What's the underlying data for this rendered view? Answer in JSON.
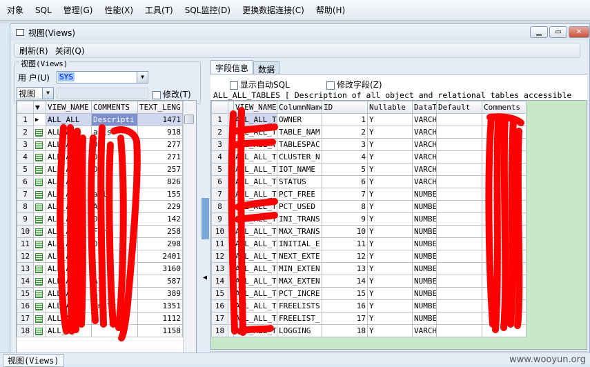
{
  "menu": [
    "对象",
    "SQL",
    "管理(G)",
    "性能(X)",
    "工具(T)",
    "SQL监控(D)",
    "更换数据连接(C)",
    "帮助(H)"
  ],
  "window": {
    "title": "视图(Views)"
  },
  "toolbar": {
    "refresh": "刷新(R)",
    "close": "关闭(Q)"
  },
  "left": {
    "group_legend": "视图(Views)",
    "user_label": "用 户(U)",
    "user_value": "SYS",
    "type_value": "视图",
    "modify_label": "修改(T)",
    "columns": [
      "VIEW_NAME",
      "COMMENTS",
      "TEXT_LENG"
    ],
    "rows": [
      {
        "n": "1",
        "name": "ALL_ALL",
        "comm": "Descripti",
        "len": "1471"
      },
      {
        "n": "2",
        "name": "ALL_AP",
        "comm": "ails",
        "len": "918"
      },
      {
        "n": "3",
        "name": "ALL_AP",
        "comm": "De",
        "len": "277"
      },
      {
        "n": "4",
        "name": "ALL_AP",
        "comm": "De",
        "len": "271"
      },
      {
        "n": "5",
        "name": "ALL_AP",
        "comm": "De",
        "len": "257"
      },
      {
        "n": "6",
        "name": "ALL_AP",
        "comm": "",
        "len": "826"
      },
      {
        "n": "7",
        "name": "ALL_AP",
        "comm": "ail",
        "len": "155"
      },
      {
        "n": "8",
        "name": "ALL_AP",
        "comm": "Ar",
        "len": "229"
      },
      {
        "n": "9",
        "name": "ALL_AP",
        "comm": "D",
        "len": "142"
      },
      {
        "n": "10",
        "name": "ALL_AP",
        "comm": "For",
        "len": "258"
      },
      {
        "n": "11",
        "name": "ALL_AP",
        "comm": "De",
        "len": "298"
      },
      {
        "n": "12",
        "name": "ALL_AR",
        "comm": "",
        "len": "2401"
      },
      {
        "n": "13",
        "name": "ALL_AS",
        "comm": "",
        "len": "3160"
      },
      {
        "n": "14",
        "name": "ALL_AU",
        "comm": "All",
        "len": "587"
      },
      {
        "n": "15",
        "name": "ALL_AU",
        "comm": "All",
        "len": "389"
      },
      {
        "n": "16",
        "name": "ALL_AW",
        "comm": "Analy",
        "len": "1351"
      },
      {
        "n": "17",
        "name": "ALL_AW",
        "comm": "",
        "len": "1112"
      },
      {
        "n": "18",
        "name": "ALL_AW",
        "comm": "",
        "len": "1158"
      }
    ]
  },
  "right": {
    "tabs": [
      "字段信息",
      "数据"
    ],
    "show_sql": "显示自动SQL",
    "modify_field": "修改字段(Z)",
    "description": "ALL_ALL_TABLES [ Description of all object and relational tables accessible",
    "columns": [
      "VIEW_NAME",
      "ColumnName",
      "ID",
      "Nullable",
      "DataT",
      "Default",
      "Comments"
    ],
    "rows": [
      {
        "n": "1",
        "v": "ALL_ALL_T",
        "c": "OWNER",
        "id": "1",
        "nl": "Y",
        "dt": "VARCH"
      },
      {
        "n": "2",
        "v": "ALL_ALL_T",
        "c": "TABLE_NAM",
        "id": "2",
        "nl": "Y",
        "dt": "VARCH"
      },
      {
        "n": "3",
        "v": "ALL_ALL_T",
        "c": "TABLESPAC",
        "id": "3",
        "nl": "Y",
        "dt": "VARCH"
      },
      {
        "n": "4",
        "v": "ALL_ALL_T",
        "c": "CLUSTER_N",
        "id": "4",
        "nl": "Y",
        "dt": "VARCH"
      },
      {
        "n": "5",
        "v": "ALL_ALL_T",
        "c": "IOT_NAME",
        "id": "5",
        "nl": "Y",
        "dt": "VARCH"
      },
      {
        "n": "6",
        "v": "ALL_ALL_T",
        "c": "STATUS",
        "id": "6",
        "nl": "Y",
        "dt": "VARCH"
      },
      {
        "n": "7",
        "v": "ALL_ALL_T",
        "c": "PCT_FREE",
        "id": "7",
        "nl": "Y",
        "dt": "NUMBE"
      },
      {
        "n": "8",
        "v": "ALL_ALL_T",
        "c": "PCT_USED",
        "id": "8",
        "nl": "Y",
        "dt": "NUMBE"
      },
      {
        "n": "9",
        "v": "ALL_ALL_T",
        "c": "INI_TRANS",
        "id": "9",
        "nl": "Y",
        "dt": "NUMBE"
      },
      {
        "n": "10",
        "v": "ALL_ALL_T",
        "c": "MAX_TRANS",
        "id": "10",
        "nl": "Y",
        "dt": "NUMBE"
      },
      {
        "n": "11",
        "v": "ALL_ALL_T",
        "c": "INITIAL_E",
        "id": "11",
        "nl": "Y",
        "dt": "NUMBE"
      },
      {
        "n": "12",
        "v": "ALL_ALL_T",
        "c": "NEXT_EXTE",
        "id": "12",
        "nl": "Y",
        "dt": "NUMBE"
      },
      {
        "n": "13",
        "v": "ALL_ALL_T",
        "c": "MIN_EXTEN",
        "id": "13",
        "nl": "Y",
        "dt": "NUMBE"
      },
      {
        "n": "14",
        "v": "ALL_ALL_T",
        "c": "MAX_EXTEN",
        "id": "14",
        "nl": "Y",
        "dt": "NUMBE"
      },
      {
        "n": "15",
        "v": "ALL_ALL_T",
        "c": "PCT_INCRE",
        "id": "15",
        "nl": "Y",
        "dt": "NUMBE"
      },
      {
        "n": "16",
        "v": "ALL_ALL_T",
        "c": "FREELISTS",
        "id": "16",
        "nl": "Y",
        "dt": "NUMBE"
      },
      {
        "n": "17",
        "v": "ALL_ALL_T",
        "c": "FREELIST_",
        "id": "17",
        "nl": "Y",
        "dt": "NUMBE"
      },
      {
        "n": "18",
        "v": "ALL_ALL_T",
        "c": "LOGGING",
        "id": "18",
        "nl": "Y",
        "dt": "VARCH"
      }
    ]
  },
  "status": {
    "tab": "视图(Views)",
    "watermark": "www.wooyun.org"
  }
}
